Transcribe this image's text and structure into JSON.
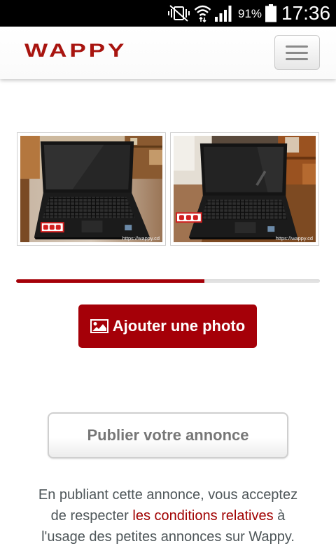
{
  "status_bar": {
    "icons": [
      "vibrate-off-icon",
      "wifi-icon",
      "signal-icon",
      "battery-icon"
    ],
    "battery": "91%",
    "time": "17:36"
  },
  "header": {
    "logo": "WAPPY",
    "menu_icon": "hamburger-icon"
  },
  "photos": [
    {
      "watermark": "https://wappy.cd"
    },
    {
      "watermark": "https://wappy.cd"
    }
  ],
  "upload": {
    "progress": 0.62,
    "add_photo_icon": "image-icon",
    "add_photo_label": "Ajouter une photo"
  },
  "publish": {
    "label": "Publier votre annonce"
  },
  "terms": {
    "before": "En publiant cette annonce, vous acceptez de respecter ",
    "link": "les conditions relatives",
    "after": " à l'usage des petites annonces sur Wappy."
  },
  "colors": {
    "brand_red": "#a50008",
    "logo_red": "#a8140f",
    "link_red": "#a00000",
    "body_text": "#4e5659",
    "button_text_gray": "#777777",
    "progress_track": "#e2e2e2"
  }
}
